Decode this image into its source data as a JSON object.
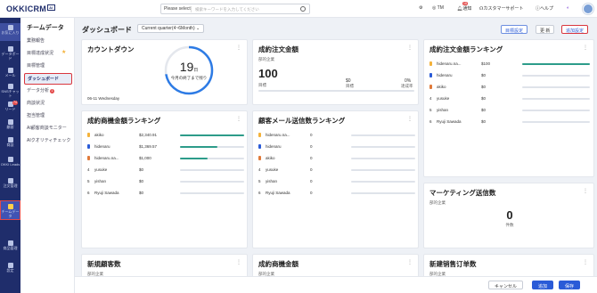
{
  "topbar": {
    "logo": "OKKICRM",
    "logo_tag": "AI",
    "search_select": "Please select",
    "search_placeholder": "検索キーワードを入力してください",
    "user_initials": "TM",
    "notice_label": "通知",
    "notice_badge": "18",
    "support_label": "カスタマーサポート",
    "help_label": "ヘルプ"
  },
  "leftnav": {
    "items": [
      {
        "label": "お気に入り",
        "icon": "star-icon"
      },
      {
        "label": "データボード",
        "icon": "board-icon"
      },
      {
        "label": "メール",
        "icon": "mail-icon"
      },
      {
        "label": "SNSチャット",
        "icon": "chat-icon",
        "badge": "74"
      },
      {
        "label": "リード",
        "icon": "lead-icon"
      },
      {
        "label": "顧客",
        "icon": "customer-icon"
      },
      {
        "label": "商談",
        "icon": "deal-icon"
      },
      {
        "label": "OKKI Leads",
        "icon": "okki-icon"
      },
      {
        "label": "注文管理",
        "icon": "order-icon"
      },
      {
        "label": "チームデータ",
        "icon": "team-icon"
      },
      {
        "label": "商品管理",
        "icon": "product-icon"
      },
      {
        "label": "設定",
        "icon": "settings-icon"
      }
    ]
  },
  "subnav": {
    "title": "チームデータ",
    "items": [
      "業務報告",
      "目標達成状況",
      "目標管理",
      "ダッシュボード",
      "データ分析",
      "商談状況",
      "担当管理",
      "AI顧客商談モニター",
      "AIクオリティチェック"
    ],
    "analysis_badge": "1"
  },
  "header": {
    "title": "ダッシュボード",
    "period": "Current quarter(4~6Month)",
    "goal_btn": "目標設定",
    "update_btn": "更 新",
    "add_btn": "追加設定"
  },
  "countdown": {
    "title": "カウントダウン",
    "days": "19",
    "unit": "日",
    "caption": "今月の終了まで残り",
    "date": "06-11 Wednesday"
  },
  "order_amount": {
    "title": "成約注文金額",
    "sub": "部的企業",
    "big": "100",
    "big_label": "目標",
    "mid": "$0",
    "mid_label": "目標",
    "pct": "0%",
    "pct_label": "達成率"
  },
  "order_rank": {
    "title": "成約注文金額ランキング",
    "rows": [
      {
        "rank": "",
        "name": "hidenaru.na...",
        "value": "$100",
        "fill": 1.0
      },
      {
        "rank": "",
        "name": "hidenaru",
        "value": "$0",
        "fill": 0
      },
      {
        "rank": "",
        "name": "akiko",
        "value": "$0",
        "fill": 0
      },
      {
        "rank": "4",
        "name": "yusuke",
        "value": "$0",
        "fill": 0
      },
      {
        "rank": "5",
        "name": "yishan",
        "value": "$0",
        "fill": 0
      },
      {
        "rank": "6",
        "name": "Ryuji Sawada",
        "value": "$0",
        "fill": 0
      }
    ]
  },
  "deal_rank": {
    "title": "成約商機金額ランキング",
    "rows": [
      {
        "rank": "",
        "name": "akiko",
        "value": "$2,340.91",
        "fill": 1.0
      },
      {
        "rank": "",
        "name": "hidenaru",
        "value": "$1,369.57",
        "fill": 0.58
      },
      {
        "rank": "",
        "name": "hidenaru.na...",
        "value": "$1,000",
        "fill": 0.43
      },
      {
        "rank": "4",
        "name": "yusuke",
        "value": "$0",
        "fill": 0
      },
      {
        "rank": "5",
        "name": "yishan",
        "value": "$0",
        "fill": 0
      },
      {
        "rank": "6",
        "name": "Ryuji Sawada",
        "value": "$0",
        "fill": 0
      }
    ]
  },
  "mail_rank": {
    "title": "顧客メール送信数ランキング",
    "rows": [
      {
        "rank": "",
        "name": "hidenaru.na...",
        "value": "0",
        "fill": 0
      },
      {
        "rank": "",
        "name": "hidenaru",
        "value": "0",
        "fill": 0
      },
      {
        "rank": "",
        "name": "akiko",
        "value": "0",
        "fill": 0
      },
      {
        "rank": "4",
        "name": "yusuke",
        "value": "0",
        "fill": 0
      },
      {
        "rank": "5",
        "name": "yishan",
        "value": "0",
        "fill": 0
      },
      {
        "rank": "6",
        "name": "Ryuji Sawada",
        "value": "0",
        "fill": 0
      }
    ]
  },
  "marketing": {
    "title": "マーケティング送信数",
    "sub": "部的企業",
    "value": "0",
    "value_label": "件数"
  },
  "new_customers": {
    "title": "新規顧客数",
    "sub": "部的企業"
  },
  "deal_amount": {
    "title": "成約商機金額",
    "sub": "部的企業"
  },
  "new_orders": {
    "title": "新建销售订单数",
    "sub": "部的企業"
  },
  "footer": {
    "cancel": "キャンセル",
    "add": "追加",
    "save": "保存"
  },
  "colors": {
    "brand": "#1f2d6b",
    "accent": "#2a5bd7",
    "bar": "#2d9c8a",
    "alert": "#d9363e"
  }
}
